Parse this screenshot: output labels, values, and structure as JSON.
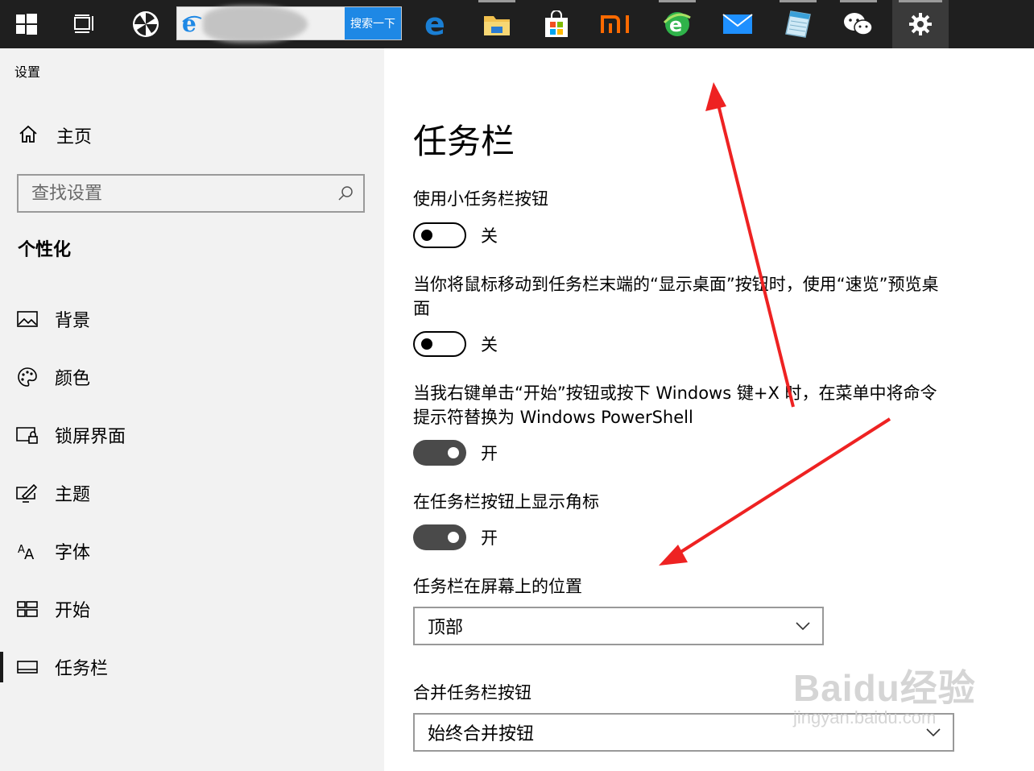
{
  "taskbar": {
    "search_button_label": "搜索一下",
    "icons": [
      "windows-start-icon",
      "task-view-icon",
      "pinwheel-app-icon",
      "edge-icon",
      "file-explorer-icon",
      "store-icon",
      "mi-icon",
      "ie-green-icon",
      "mail-icon",
      "notepad-icon",
      "wechat-icon",
      "settings-gear-icon"
    ]
  },
  "sidebar": {
    "app_title": "设置",
    "home_label": "主页",
    "search_placeholder": "查找设置",
    "section_title": "个性化",
    "items": [
      {
        "label": "背景",
        "icon": "picture-icon"
      },
      {
        "label": "颜色",
        "icon": "palette-icon"
      },
      {
        "label": "锁屏界面",
        "icon": "lock-screen-icon"
      },
      {
        "label": "主题",
        "icon": "theme-brush-icon"
      },
      {
        "label": "字体",
        "icon": "font-icon"
      },
      {
        "label": "开始",
        "icon": "start-tiles-icon"
      },
      {
        "label": "任务栏",
        "icon": "taskbar-icon",
        "selected": true
      }
    ]
  },
  "main": {
    "title": "任务栏",
    "settings": [
      {
        "label": "使用小任务栏按钮",
        "state": "关",
        "on": false
      },
      {
        "label": "当你将鼠标移动到任务栏末端的“显示桌面”按钮时，使用“速览”预览桌面",
        "state": "关",
        "on": false
      },
      {
        "label": "当我右键单击“开始”按钮或按下 Windows 键+X 时，在菜单中将命令提示符替换为 Windows PowerShell",
        "state": "开",
        "on": true
      },
      {
        "label": "在任务栏按钮上显示角标",
        "state": "开",
        "on": true
      }
    ],
    "position": {
      "label": "任务栏在屏幕上的位置",
      "value": "顶部"
    },
    "combine": {
      "label": "合并任务栏按钮",
      "value": "始终合并按钮"
    }
  },
  "watermark": {
    "brand": "Baidu经验",
    "url": "jingyan.baidu.com"
  },
  "colors": {
    "taskbar": "#1f1f1f",
    "sidebar": "#f2f2f2",
    "arrow": "#ee2222",
    "search_button": "#1e88e5"
  }
}
